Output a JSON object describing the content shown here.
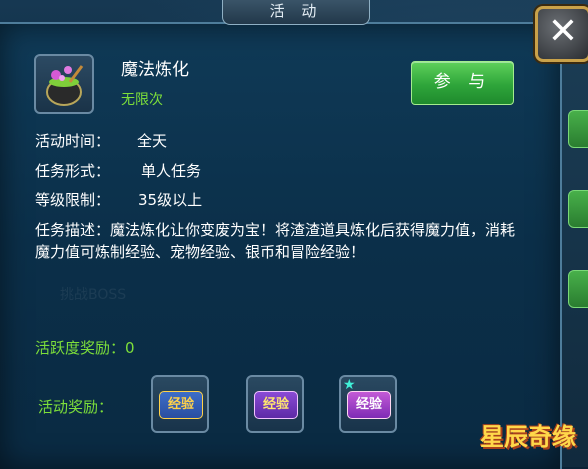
{
  "window": {
    "title": "活 动",
    "close_glyph": "✕"
  },
  "activity": {
    "name": "魔法炼化",
    "limit": "无限次",
    "join_label": "参 与",
    "icon": "cauldron-icon"
  },
  "details": [
    {
      "label": "活动时间：",
      "value": "全天"
    },
    {
      "label": "任务形式：",
      "value": "单人任务"
    },
    {
      "label": "等级限制：",
      "value": "35级以上"
    }
  ],
  "description": {
    "label": "任务描述：",
    "text": "魔法炼化让你变废为宝！将渣渣道具炼化后获得魔力值，消耗魔力值可炼制经验、宠物经验、银币和冒险经验！"
  },
  "active_reward": "活跃度奖励：0",
  "rewards": {
    "label": "活动奖励：",
    "items": [
      {
        "label": "经验"
      },
      {
        "label": "经验"
      },
      {
        "label": "经验"
      }
    ]
  },
  "logo": {
    "text": "星辰奇缘"
  },
  "colors": {
    "accent_green": "#7ddf3a",
    "button_green": "#2ea53a",
    "gold_border": "#c9a24a"
  }
}
